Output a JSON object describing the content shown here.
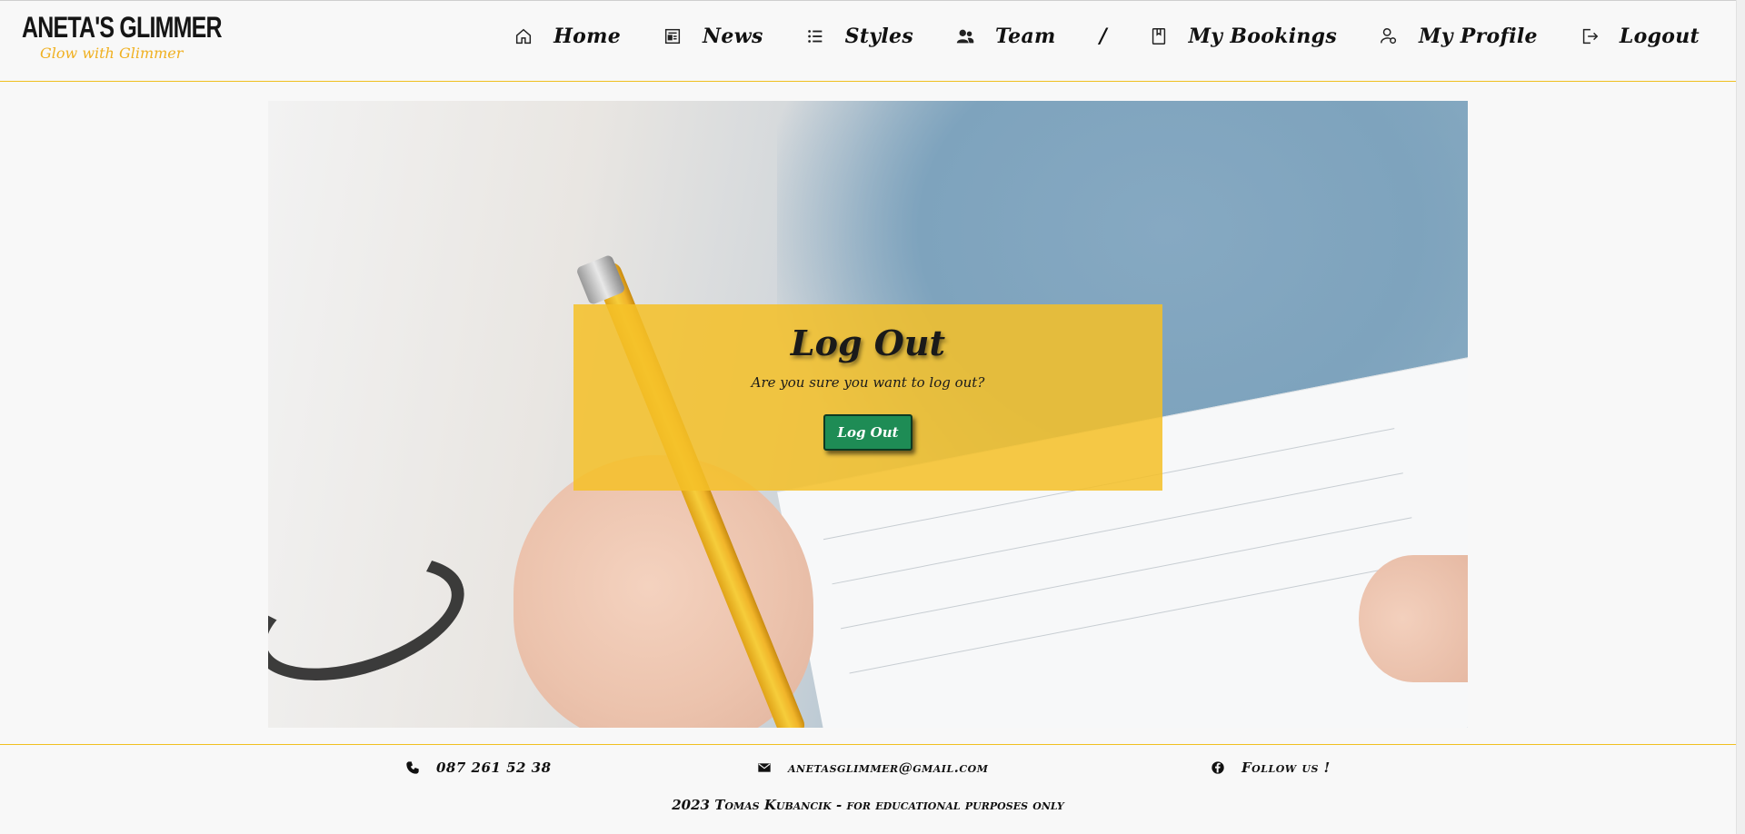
{
  "brand": {
    "title": "ANETA'S GLIMMER",
    "tagline": "Glow with Glimmer"
  },
  "nav": {
    "items": [
      {
        "label": "Home",
        "icon": "home-icon"
      },
      {
        "label": "News",
        "icon": "newspaper-icon"
      },
      {
        "label": "Styles",
        "icon": "list-icon"
      },
      {
        "label": "Team",
        "icon": "users-icon"
      },
      {
        "label": "My Bookings",
        "icon": "notebook-icon"
      },
      {
        "label": "My Profile",
        "icon": "user-gear-icon"
      },
      {
        "label": "Logout",
        "icon": "logout-icon"
      }
    ],
    "separator": "/"
  },
  "logout_card": {
    "title": "Log Out",
    "message": "Are you sure you want to log out?",
    "button_label": "Log Out"
  },
  "footer": {
    "phone": "087 261 52 38",
    "email": "anetasglimmer@gmail.com",
    "social": "Follow us !",
    "copyright": "2023 Tomas Kubancik - for educational purposes only"
  },
  "colors": {
    "accent": "#f0c020",
    "button": "#1e8c55",
    "card_overlay": "#f5c028"
  }
}
